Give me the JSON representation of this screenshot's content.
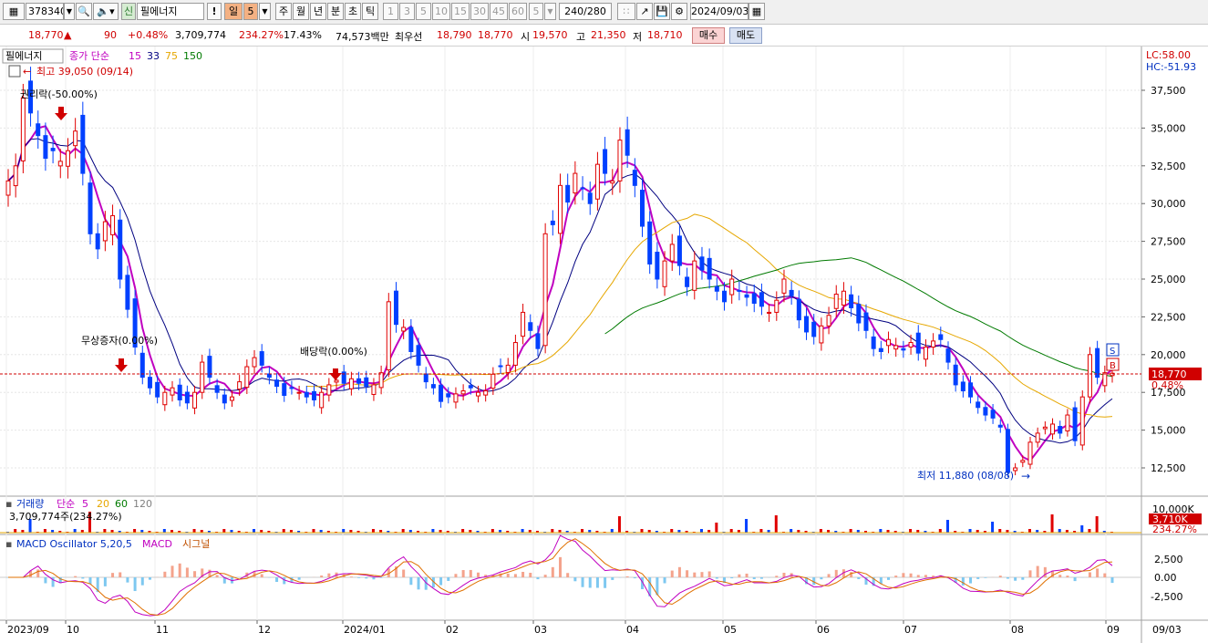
{
  "toolbar": {
    "code": "378340",
    "market_badge": "신",
    "stock_name": "필에너지",
    "warning": "!",
    "period_selected": "일",
    "period_num": "5",
    "periods": [
      "주",
      "월",
      "년",
      "분",
      "초",
      "틱"
    ],
    "intervals": [
      "1",
      "3",
      "5",
      "10",
      "15",
      "30",
      "45",
      "60"
    ],
    "interval_value": "5",
    "count_display": "240/280",
    "date": "2024/09/03"
  },
  "quote": {
    "price": "18,770",
    "arrow": "▲",
    "change": "90",
    "change_pct": "+0.48%",
    "volume": "3,709,774",
    "volume_ratio": "234.27%",
    "turnover": "17.43%",
    "amount": "74,573백만",
    "best_ask_label": "최우선",
    "best_ask": "18,790",
    "best_bid": "18,770",
    "open_label": "시",
    "open": "19,570",
    "high_label": "고",
    "high": "21,350",
    "low_label": "저",
    "low": "18,710",
    "buy_label": "매수",
    "sell_label": "매도"
  },
  "price_panel": {
    "name": "필에너지",
    "ma_label": "종가 단순",
    "ma_periods": [
      "15",
      "33",
      "75",
      "150"
    ],
    "ma_colors": [
      "#c000c0",
      "#000080",
      "#e6a700",
      "#007a00"
    ],
    "lc_label": "LC:58.00",
    "hc_label": "HC:-51.93",
    "high_note": "최고 39,050 (09/14)",
    "low_note": "최저 11,880 (08/08)",
    "events": [
      "권리락(-50.00%)",
      "무상증자(0.00%)",
      "배당락(0.00%)"
    ],
    "current_price_tag": "18,770",
    "current_pct_tag": "0.48%",
    "sell_marker": "S",
    "buy_marker": "B",
    "y_ticks": [
      "37,500",
      "35,000",
      "32,500",
      "30,000",
      "27,500",
      "25,000",
      "22,500",
      "20,000",
      "17,500",
      "15,000",
      "12,500"
    ]
  },
  "volume_panel": {
    "label": "거래량",
    "ma_label": "단순",
    "ma_periods": [
      "5",
      "20",
      "60",
      "120"
    ],
    "ma_colors": [
      "#c000c0",
      "#e6a700",
      "#007a00",
      "#808080"
    ],
    "current": "3,709,774주(234.27%)",
    "y_tick": "10,000K",
    "tag_value": "3,710K",
    "tag_pct": "234.27%"
  },
  "macd_panel": {
    "label": "MACD Oscillator 5,20,5",
    "macd_label": "MACD",
    "signal_label": "시그널",
    "y_ticks": [
      "2,500",
      "0.00",
      "-2,500"
    ]
  },
  "x_axis": {
    "labels": [
      "2023/09",
      "10",
      "11",
      "12",
      "2024/01",
      "02",
      "03",
      "04",
      "05",
      "06",
      "07",
      "08",
      "09"
    ],
    "right_label": "09/03"
  },
  "chart_data": {
    "type": "candlestick",
    "price_range": [
      11000,
      39500
    ],
    "closes": [
      31500,
      32500,
      37000,
      36000,
      34500,
      33000,
      33500,
      32800,
      33500,
      34800,
      32000,
      28000,
      27000,
      28800,
      29200,
      25000,
      23000,
      20500,
      18500,
      17800,
      17200,
      17500,
      17800,
      17000,
      16800,
      17500,
      19500,
      18500,
      17500,
      16800,
      17200,
      18200,
      19200,
      19800,
      19300,
      18500,
      17900,
      17300,
      17800,
      17500,
      17200,
      17000,
      17500,
      18000,
      18300,
      18100,
      18400,
      18100,
      17900,
      18000,
      18800,
      23500,
      22000,
      21800,
      20200,
      19300,
      18200,
      17800,
      16900,
      17200,
      17400,
      17600,
      17800,
      17500,
      17600,
      18700,
      19200,
      19300,
      20800,
      22800,
      21600,
      20400,
      28000,
      28600,
      31200,
      30100,
      32000,
      31000,
      30000,
      32600,
      32000,
      31500,
      34200,
      33200,
      31200,
      28500,
      26000,
      25000,
      26200,
      27300,
      25900,
      24500,
      26200,
      25600,
      25000,
      24200,
      23500,
      25000,
      24200,
      23800,
      23400,
      23200,
      22800,
      23600,
      25000,
      23900,
      22300,
      21500,
      21200,
      21900,
      22600,
      24000,
      24200,
      23100,
      22100,
      21600,
      20400,
      20200,
      21000,
      20600,
      20300,
      20800,
      20100,
      20500,
      20900,
      21000,
      19500,
      18000,
      17600,
      17200,
      16500,
      16000,
      15800,
      15200,
      12200,
      12500,
      13000,
      14200,
      14800,
      15200,
      15400,
      14800,
      16000,
      14300,
      17200,
      20000,
      18500,
      18800,
      18770
    ],
    "volume_share_note": "volume histogram with spikes",
    "series": [
      {
        "name": "15"
      },
      {
        "name": "33"
      },
      {
        "name": "75"
      },
      {
        "name": "150"
      }
    ]
  }
}
